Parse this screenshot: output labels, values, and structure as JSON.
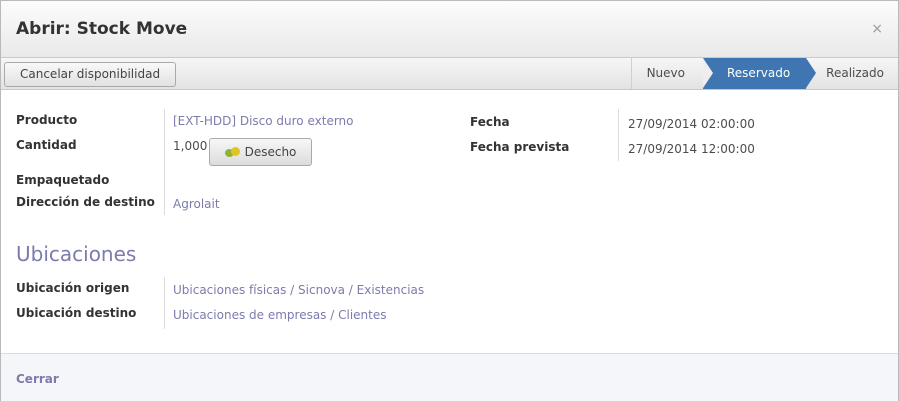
{
  "dialog": {
    "title": "Abrir: Stock Move",
    "close_glyph": "×"
  },
  "toolbar": {
    "cancel_label": "Cancelar disponibilidad",
    "stages": [
      {
        "label": "Nuevo",
        "active": false
      },
      {
        "label": "Reservado",
        "active": true
      },
      {
        "label": "Realizado",
        "active": false
      }
    ],
    "active_color": "#3f75b0"
  },
  "form": {
    "producto_label": "Producto",
    "producto_value": "[EXT-HDD] Disco duro externo",
    "cantidad_label": "Cantidad",
    "cantidad_value": "1,000",
    "desecho_label": "Desecho",
    "desecho_icon": "scrap-icon",
    "empaquetado_label": "Empaquetado",
    "direccion_label": "Dirección de destino",
    "direccion_value": "Agrolait",
    "fecha_label": "Fecha",
    "fecha_value": "27/09/2014 02:00:00",
    "fecha_prevista_label": "Fecha prevista",
    "fecha_prevista_value": "27/09/2014 12:00:00"
  },
  "ubicaciones": {
    "title": "Ubicaciones",
    "origen_label": "Ubicación origen",
    "origen_value": "Ubicaciones físicas / Sicnova / Existencias",
    "destino_label": "Ubicación destino",
    "destino_value": "Ubicaciones de empresas / Clientes"
  },
  "footer": {
    "cerrar_label": "Cerrar"
  },
  "colors": {
    "link": "#7c7bad",
    "accent": "#3f75b0"
  }
}
